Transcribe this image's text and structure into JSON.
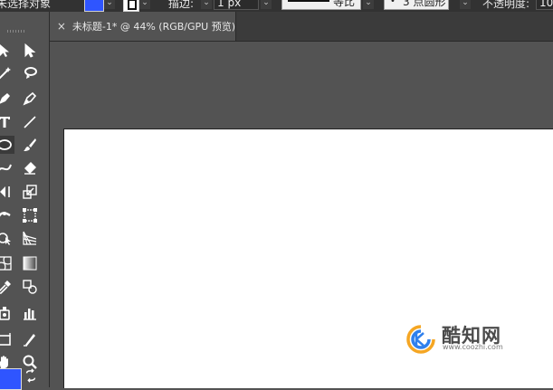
{
  "control_bar": {
    "selection_label": "未选择对象",
    "stroke_label": "描边:",
    "stroke_weight": "1 px",
    "stroke_profile": "等比",
    "brush": "3 点圆形",
    "opacity_label": "不透明度:",
    "opacity_value": "10",
    "fill_color": "#2f55ff",
    "stroke_color": "#111111"
  },
  "document_tab": {
    "title": "未标题-1* @ 44% (RGB/GPU 预览)",
    "close_icon": "×"
  },
  "toolbar": {
    "tools": [
      "selection-tool",
      "direct-selection-tool",
      "magic-wand-tool",
      "lasso-tool",
      "pen-tool",
      "curvature-tool",
      "type-tool",
      "line-segment-tool",
      "ellipse-tool",
      "paintbrush-tool",
      "shaper-tool",
      "eraser-tool",
      "rotate-tool",
      "scale-tool",
      "width-tool",
      "free-transform-tool",
      "shape-builder-tool",
      "perspective-grid-tool",
      "mesh-tool",
      "gradient-tool",
      "eyedropper-tool",
      "blend-tool",
      "symbol-sprayer-tool",
      "column-graph-tool",
      "artboard-tool",
      "slice-tool",
      "hand-tool",
      "zoom-tool"
    ],
    "active_tool": "ellipse-tool",
    "fill_color": "#2f55ff"
  },
  "watermark": {
    "brand_cn": "酷知网",
    "url": "www.coozhi.com"
  }
}
